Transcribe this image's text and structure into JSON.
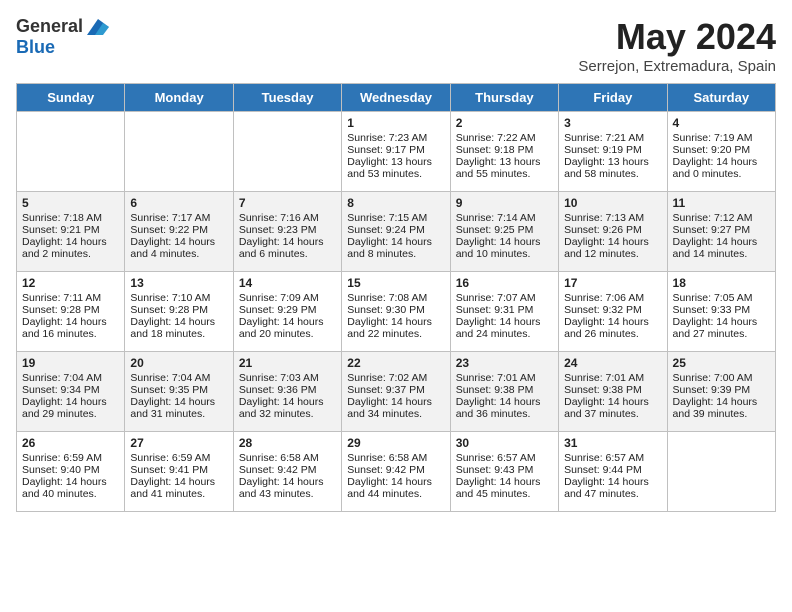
{
  "header": {
    "logo_general": "General",
    "logo_blue": "Blue",
    "title": "May 2024",
    "subtitle": "Serrejon, Extremadura, Spain"
  },
  "days_of_week": [
    "Sunday",
    "Monday",
    "Tuesday",
    "Wednesday",
    "Thursday",
    "Friday",
    "Saturday"
  ],
  "weeks": [
    [
      {
        "day": "",
        "content": ""
      },
      {
        "day": "",
        "content": ""
      },
      {
        "day": "",
        "content": ""
      },
      {
        "day": "1",
        "content": "Sunrise: 7:23 AM\nSunset: 9:17 PM\nDaylight: 13 hours\nand 53 minutes."
      },
      {
        "day": "2",
        "content": "Sunrise: 7:22 AM\nSunset: 9:18 PM\nDaylight: 13 hours\nand 55 minutes."
      },
      {
        "day": "3",
        "content": "Sunrise: 7:21 AM\nSunset: 9:19 PM\nDaylight: 13 hours\nand 58 minutes."
      },
      {
        "day": "4",
        "content": "Sunrise: 7:19 AM\nSunset: 9:20 PM\nDaylight: 14 hours\nand 0 minutes."
      }
    ],
    [
      {
        "day": "5",
        "content": "Sunrise: 7:18 AM\nSunset: 9:21 PM\nDaylight: 14 hours\nand 2 minutes."
      },
      {
        "day": "6",
        "content": "Sunrise: 7:17 AM\nSunset: 9:22 PM\nDaylight: 14 hours\nand 4 minutes."
      },
      {
        "day": "7",
        "content": "Sunrise: 7:16 AM\nSunset: 9:23 PM\nDaylight: 14 hours\nand 6 minutes."
      },
      {
        "day": "8",
        "content": "Sunrise: 7:15 AM\nSunset: 9:24 PM\nDaylight: 14 hours\nand 8 minutes."
      },
      {
        "day": "9",
        "content": "Sunrise: 7:14 AM\nSunset: 9:25 PM\nDaylight: 14 hours\nand 10 minutes."
      },
      {
        "day": "10",
        "content": "Sunrise: 7:13 AM\nSunset: 9:26 PM\nDaylight: 14 hours\nand 12 minutes."
      },
      {
        "day": "11",
        "content": "Sunrise: 7:12 AM\nSunset: 9:27 PM\nDaylight: 14 hours\nand 14 minutes."
      }
    ],
    [
      {
        "day": "12",
        "content": "Sunrise: 7:11 AM\nSunset: 9:28 PM\nDaylight: 14 hours\nand 16 minutes."
      },
      {
        "day": "13",
        "content": "Sunrise: 7:10 AM\nSunset: 9:28 PM\nDaylight: 14 hours\nand 18 minutes."
      },
      {
        "day": "14",
        "content": "Sunrise: 7:09 AM\nSunset: 9:29 PM\nDaylight: 14 hours\nand 20 minutes."
      },
      {
        "day": "15",
        "content": "Sunrise: 7:08 AM\nSunset: 9:30 PM\nDaylight: 14 hours\nand 22 minutes."
      },
      {
        "day": "16",
        "content": "Sunrise: 7:07 AM\nSunset: 9:31 PM\nDaylight: 14 hours\nand 24 minutes."
      },
      {
        "day": "17",
        "content": "Sunrise: 7:06 AM\nSunset: 9:32 PM\nDaylight: 14 hours\nand 26 minutes."
      },
      {
        "day": "18",
        "content": "Sunrise: 7:05 AM\nSunset: 9:33 PM\nDaylight: 14 hours\nand 27 minutes."
      }
    ],
    [
      {
        "day": "19",
        "content": "Sunrise: 7:04 AM\nSunset: 9:34 PM\nDaylight: 14 hours\nand 29 minutes."
      },
      {
        "day": "20",
        "content": "Sunrise: 7:04 AM\nSunset: 9:35 PM\nDaylight: 14 hours\nand 31 minutes."
      },
      {
        "day": "21",
        "content": "Sunrise: 7:03 AM\nSunset: 9:36 PM\nDaylight: 14 hours\nand 32 minutes."
      },
      {
        "day": "22",
        "content": "Sunrise: 7:02 AM\nSunset: 9:37 PM\nDaylight: 14 hours\nand 34 minutes."
      },
      {
        "day": "23",
        "content": "Sunrise: 7:01 AM\nSunset: 9:38 PM\nDaylight: 14 hours\nand 36 minutes."
      },
      {
        "day": "24",
        "content": "Sunrise: 7:01 AM\nSunset: 9:38 PM\nDaylight: 14 hours\nand 37 minutes."
      },
      {
        "day": "25",
        "content": "Sunrise: 7:00 AM\nSunset: 9:39 PM\nDaylight: 14 hours\nand 39 minutes."
      }
    ],
    [
      {
        "day": "26",
        "content": "Sunrise: 6:59 AM\nSunset: 9:40 PM\nDaylight: 14 hours\nand 40 minutes."
      },
      {
        "day": "27",
        "content": "Sunrise: 6:59 AM\nSunset: 9:41 PM\nDaylight: 14 hours\nand 41 minutes."
      },
      {
        "day": "28",
        "content": "Sunrise: 6:58 AM\nSunset: 9:42 PM\nDaylight: 14 hours\nand 43 minutes."
      },
      {
        "day": "29",
        "content": "Sunrise: 6:58 AM\nSunset: 9:42 PM\nDaylight: 14 hours\nand 44 minutes."
      },
      {
        "day": "30",
        "content": "Sunrise: 6:57 AM\nSunset: 9:43 PM\nDaylight: 14 hours\nand 45 minutes."
      },
      {
        "day": "31",
        "content": "Sunrise: 6:57 AM\nSunset: 9:44 PM\nDaylight: 14 hours\nand 47 minutes."
      },
      {
        "day": "",
        "content": ""
      }
    ]
  ]
}
